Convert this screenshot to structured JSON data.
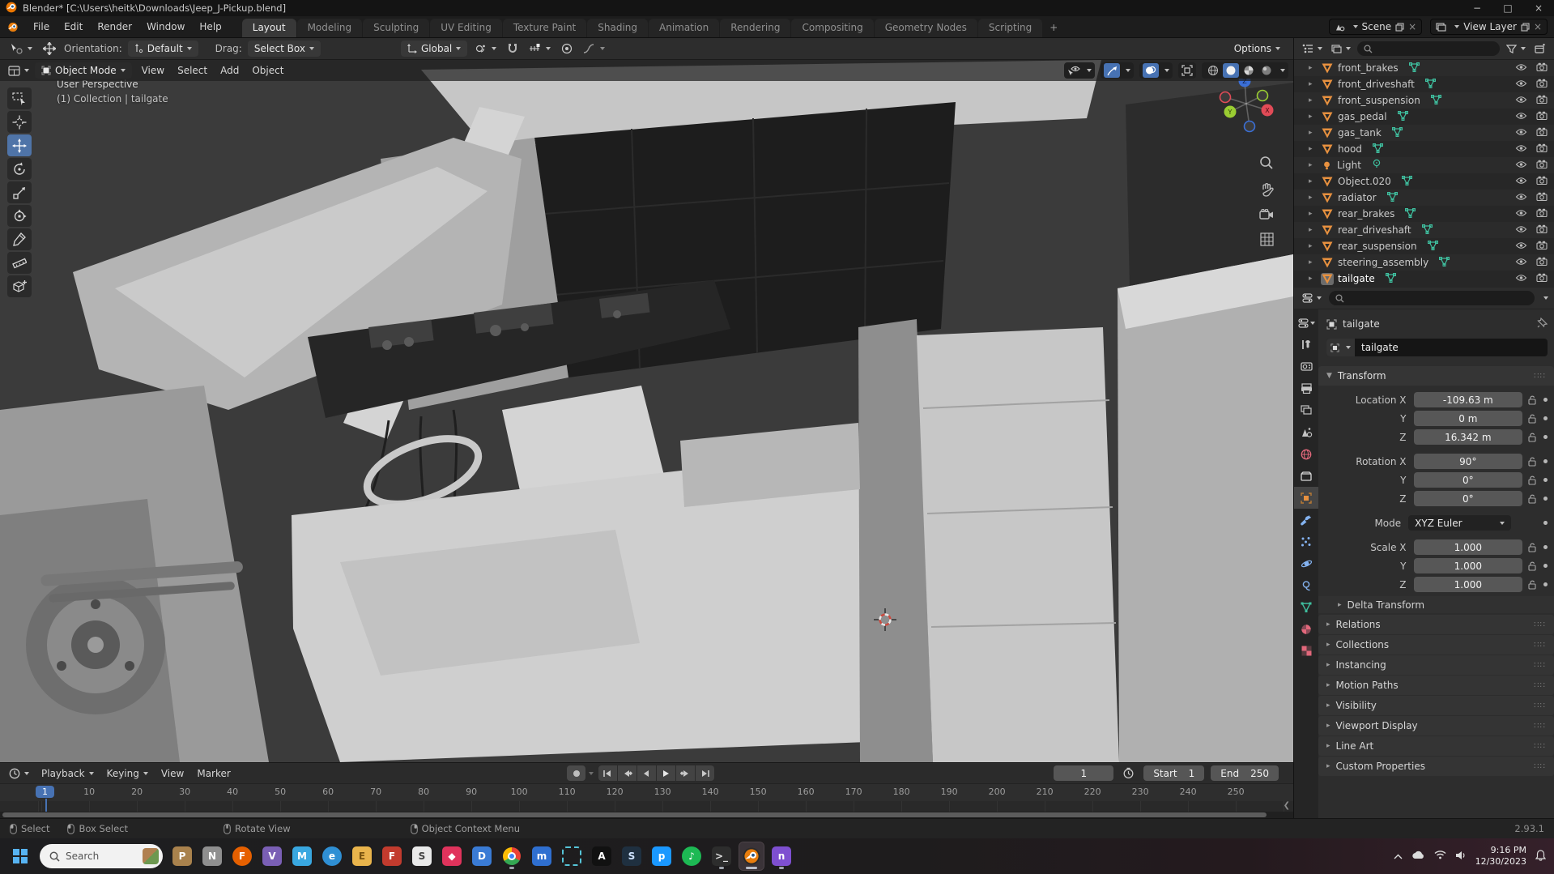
{
  "window": {
    "title": "Blender* [C:\\Users\\heitk\\Downloads\\Jeep_J-Pickup.blend]",
    "controls": {
      "minimize": "−",
      "maximize": "□",
      "close": "×"
    }
  },
  "topbar": {
    "menus": [
      "File",
      "Edit",
      "Render",
      "Window",
      "Help"
    ],
    "tabs": [
      "Layout",
      "Modeling",
      "Sculpting",
      "UV Editing",
      "Texture Paint",
      "Shading",
      "Animation",
      "Rendering",
      "Compositing",
      "Geometry Nodes",
      "Scripting"
    ],
    "active_tab": "Layout",
    "add_tab_label": "+",
    "scene_label": "Scene",
    "view_layer_label": "View Layer"
  },
  "tool_settings": {
    "orientation_label": "Orientation:",
    "orientation_value": "Default",
    "drag_label": "Drag:",
    "drag_value": "Select Box",
    "transform_orientation": "Global",
    "options_label": "Options"
  },
  "viewport": {
    "mode": "Object Mode",
    "menus": [
      "View",
      "Select",
      "Add",
      "Object"
    ],
    "overlay_line1": "User Perspective",
    "overlay_line2": "(1) Collection | tailgate",
    "tools": [
      "select-box",
      "cursor",
      "move",
      "rotate",
      "scale",
      "transform",
      "annotate",
      "measure",
      "add-cube"
    ],
    "active_tool": "move",
    "axis_labels": {
      "x": "X",
      "y": "Y",
      "z": "Z"
    }
  },
  "outliner": {
    "rows": [
      {
        "name": "front_brakes",
        "type": "mesh"
      },
      {
        "name": "front_driveshaft",
        "type": "mesh"
      },
      {
        "name": "front_suspension",
        "type": "mesh"
      },
      {
        "name": "gas_pedal",
        "type": "mesh"
      },
      {
        "name": "gas_tank",
        "type": "mesh"
      },
      {
        "name": "hood",
        "type": "mesh"
      },
      {
        "name": "Light",
        "type": "light"
      },
      {
        "name": "Object.020",
        "type": "mesh"
      },
      {
        "name": "radiator",
        "type": "mesh"
      },
      {
        "name": "rear_brakes",
        "type": "mesh"
      },
      {
        "name": "rear_driveshaft",
        "type": "mesh"
      },
      {
        "name": "rear_suspension",
        "type": "mesh"
      },
      {
        "name": "steering_assembly",
        "type": "mesh"
      },
      {
        "name": "tailgate",
        "type": "mesh",
        "selected": true
      }
    ]
  },
  "properties": {
    "breadcrumb_object": "tailgate",
    "object_name": "tailgate",
    "tabs": [
      "tool",
      "render",
      "output",
      "view-layer",
      "scene",
      "world",
      "collection",
      "object",
      "modifiers",
      "particles",
      "physics",
      "constraints",
      "data",
      "material",
      "texture"
    ],
    "active_tab": "object",
    "transform": {
      "title": "Transform",
      "location_rows": [
        {
          "label": "Location X",
          "value": "-109.63 m"
        },
        {
          "label": "Y",
          "value": "0 m"
        },
        {
          "label": "Z",
          "value": "16.342 m"
        }
      ],
      "rotation_rows": [
        {
          "label": "Rotation X",
          "value": "90°"
        },
        {
          "label": "Y",
          "value": "0°"
        },
        {
          "label": "Z",
          "value": "0°"
        }
      ],
      "mode_label": "Mode",
      "mode_value": "XYZ Euler",
      "scale_rows": [
        {
          "label": "Scale X",
          "value": "1.000"
        },
        {
          "label": "Y",
          "value": "1.000"
        },
        {
          "label": "Z",
          "value": "1.000"
        }
      ],
      "delta_label": "Delta Transform"
    },
    "sections": [
      "Relations",
      "Collections",
      "Instancing",
      "Motion Paths",
      "Visibility",
      "Viewport Display",
      "Line Art",
      "Custom Properties"
    ]
  },
  "timeline": {
    "menus": [
      {
        "label": "Playback",
        "dropdown": true
      },
      {
        "label": "Keying",
        "dropdown": true
      },
      {
        "label": "View",
        "dropdown": false
      },
      {
        "label": "Marker",
        "dropdown": false
      }
    ],
    "current_frame": "1",
    "frame_field": "1",
    "start_label": "Start",
    "start_value": "1",
    "end_label": "End",
    "end_value": "250",
    "ticks": [
      10,
      20,
      30,
      40,
      50,
      60,
      70,
      80,
      90,
      100,
      110,
      120,
      130,
      140,
      150,
      160,
      170,
      180,
      190,
      200,
      210,
      220,
      230,
      240,
      250
    ]
  },
  "statusbar": {
    "hints": [
      {
        "label": "Select",
        "button": "left"
      },
      {
        "label": "Box Select",
        "button": "left"
      },
      {
        "label": "Rotate View",
        "button": "middle"
      },
      {
        "label": "Object Context Menu",
        "button": "right"
      }
    ],
    "version": "2.93.1"
  },
  "taskbar": {
    "search_label": "Search",
    "time": "9:16 PM",
    "date": "12/30/2023",
    "apps": [
      {
        "name": "taskbar-app-photos",
        "glyph": "P",
        "bg": "#a9824d",
        "fg": "#fff"
      },
      {
        "name": "taskbar-app-notes",
        "glyph": "N",
        "bg": "#8f8f8f",
        "fg": "#fff"
      },
      {
        "name": "taskbar-app-firefox",
        "glyph": "F",
        "bg": "#e66000",
        "fg": "#fff",
        "round": true
      },
      {
        "name": "taskbar-app-media",
        "glyph": "V",
        "bg": "#7a5fb5",
        "fg": "#fff"
      },
      {
        "name": "taskbar-app-mail",
        "glyph": "M",
        "bg": "#39a7e0",
        "fg": "#fff"
      },
      {
        "name": "taskbar-app-edge",
        "glyph": "e",
        "bg": "#2f8fd4",
        "fg": "#fff",
        "round": true
      },
      {
        "name": "taskbar-app-explorer",
        "glyph": "E",
        "bg": "#e9b44c",
        "fg": "#7a5410"
      },
      {
        "name": "taskbar-app-f",
        "glyph": "F",
        "bg": "#c23b2e",
        "fg": "#fff"
      },
      {
        "name": "taskbar-app-store",
        "glyph": "S",
        "bg": "#e9e9e9",
        "fg": "#444"
      },
      {
        "name": "taskbar-app-diamond",
        "glyph": "◆",
        "bg": "#e0335c",
        "fg": "#fff"
      },
      {
        "name": "taskbar-app-dropbox",
        "glyph": "D",
        "bg": "#3a7bd5",
        "fg": "#fff"
      },
      {
        "name": "taskbar-app-chrome",
        "chrome": true,
        "running": true
      },
      {
        "name": "taskbar-app-mhfp",
        "glyph": "m",
        "bg": "#2f6fd0",
        "fg": "#fff"
      },
      {
        "name": "taskbar-app-snip",
        "glyph": "",
        "dashed": true
      },
      {
        "name": "taskbar-app-a",
        "glyph": "A",
        "bg": "#111111",
        "fg": "#fff"
      },
      {
        "name": "taskbar-app-steam",
        "glyph": "S",
        "bg": "#1f3040",
        "fg": "#cfe3ff"
      },
      {
        "name": "taskbar-app-prime",
        "glyph": "p",
        "bg": "#1a98ff",
        "fg": "#fff"
      },
      {
        "name": "taskbar-app-spotify",
        "glyph": "♪",
        "bg": "#1db954",
        "fg": "#fff",
        "round": true
      },
      {
        "name": "taskbar-app-terminal",
        "glyph": ">_",
        "bg": "#2d2d2d",
        "fg": "#ddd",
        "running": true
      },
      {
        "name": "taskbar-app-blender",
        "blender": true,
        "active": true,
        "running": true
      },
      {
        "name": "taskbar-app-horn",
        "glyph": "n",
        "bg": "#7e4fd0",
        "fg": "#fff",
        "running": true
      }
    ]
  },
  "colors": {
    "accent": "#4772b3",
    "object_orange": "#e8913f",
    "data_green": "#3fbf9f"
  }
}
